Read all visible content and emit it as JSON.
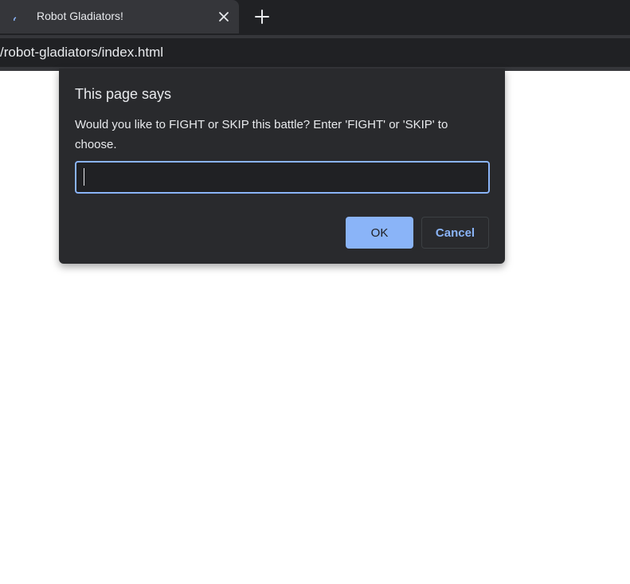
{
  "browser": {
    "tab": {
      "title": "Robot Gladiators!",
      "favicon_icon": "loading-spinner-icon",
      "close_icon": "close-icon"
    },
    "new_tab_icon": "plus-icon",
    "address_bar": {
      "url": "/robot-gladiators/index.html"
    }
  },
  "dialog": {
    "title": "This page says",
    "message": "Would you like to FIGHT or SKIP this battle? Enter 'FIGHT' or 'SKIP' to choose.",
    "input_value": "",
    "ok_label": "OK",
    "cancel_label": "Cancel"
  },
  "colors": {
    "tabstrip_bg": "#202124",
    "active_tab_bg": "#35363a",
    "dialog_bg": "#292a2d",
    "accent": "#8ab4f8"
  }
}
